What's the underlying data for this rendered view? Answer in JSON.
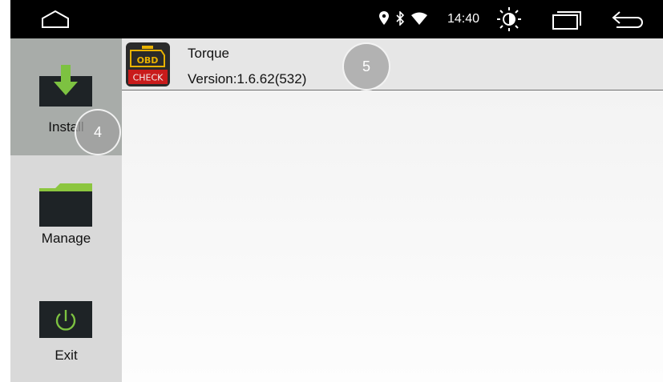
{
  "statusbar": {
    "time": "14:40",
    "icons": [
      "home-icon",
      "location-icon",
      "bluetooth-icon",
      "wifi-icon",
      "brightness-icon",
      "recent-apps-icon",
      "back-icon"
    ]
  },
  "sidebar": {
    "items": [
      {
        "label": "Install",
        "icon": "download-icon",
        "active": true
      },
      {
        "label": "Manage",
        "icon": "folder-icon",
        "active": false
      },
      {
        "label": "Exit",
        "icon": "power-icon",
        "active": false
      }
    ]
  },
  "apps": [
    {
      "name": "Torque",
      "version": "Version:1.6.62(532)",
      "icon_text_top": "OBD",
      "icon_text_bottom": "CHECK"
    }
  ],
  "badges": {
    "install": "4",
    "app_row": "5"
  },
  "colors": {
    "statusbar": "#000000",
    "sidebar": "#d9d9d9",
    "sidebar_active": "#a8aca9",
    "download_green": "#7dc241",
    "folder_green": "#8cc63f",
    "power_green": "#7dc241",
    "app_row": "#e6e6e6"
  }
}
